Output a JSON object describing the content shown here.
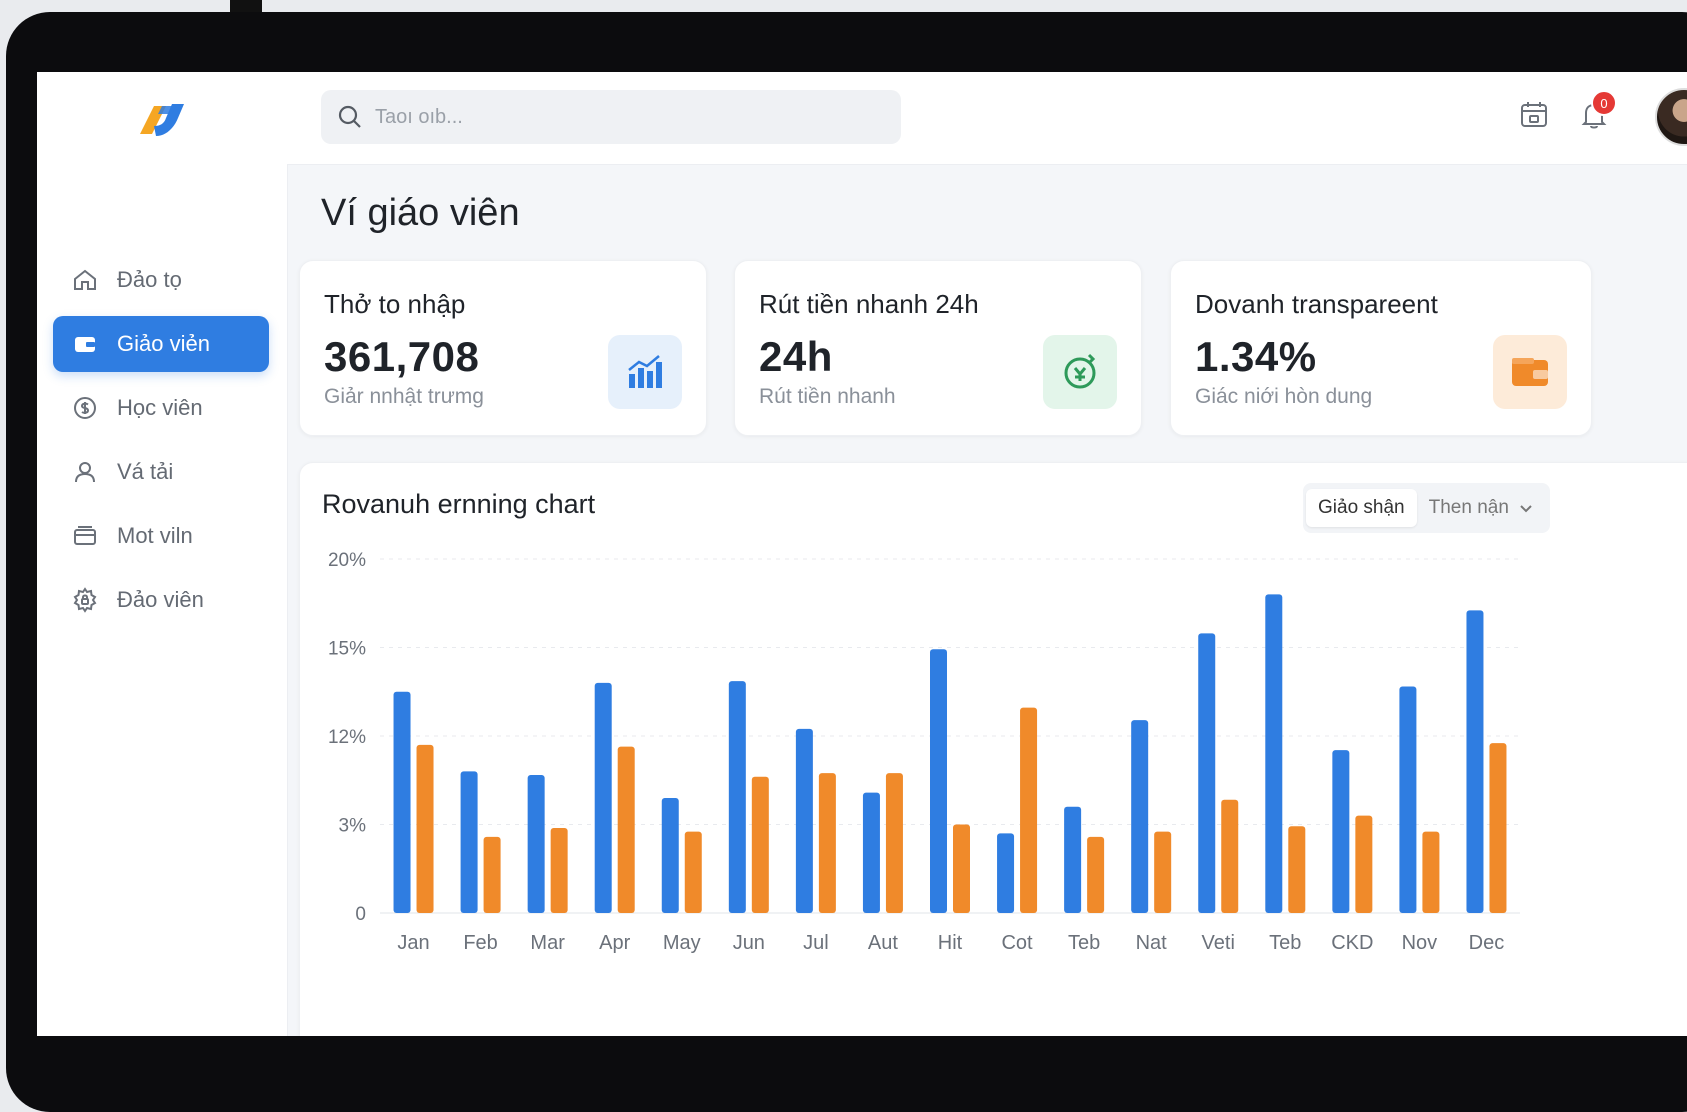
{
  "app": {
    "search_placeholder": "Taoı oıb...",
    "notification_count": "0"
  },
  "sidebar": {
    "items": [
      {
        "label": "Đảo tọ",
        "icon": "home-icon",
        "active": false
      },
      {
        "label": "Giảo viẻn",
        "icon": "wallet-icon",
        "active": true
      },
      {
        "label": "Học viên",
        "icon": "dollar-circle-icon",
        "active": false
      },
      {
        "label": "Vá tải",
        "icon": "user-icon",
        "active": false
      },
      {
        "label": "Mot viln",
        "icon": "card-icon",
        "active": false
      },
      {
        "label": "Đảo viên",
        "icon": "settings-lock-icon",
        "active": false
      }
    ]
  },
  "page": {
    "title": "Ví giáo viên"
  },
  "cards": [
    {
      "title": "Thở to nhập",
      "value": "361,708",
      "sub": "Giảr nnhật trưmg",
      "icon": "bar-chart-icon",
      "icon_bg": "#e6f0fb",
      "icon_color": "#2f7de1"
    },
    {
      "title": "Rút tiền nhanh 24h",
      "value": "24h",
      "sub": "Rút tiền nhanh",
      "icon": "money-clock-icon",
      "icon_bg": "#e3f5ea",
      "icon_color": "#2e9a5a"
    },
    {
      "title": "Dovanh transpareent",
      "value": "1.34%",
      "sub": "Giác niới hòn dung",
      "icon": "wallet-orange-icon",
      "icon_bg": "#fdebd9",
      "icon_color": "#f08a2a"
    }
  ],
  "chart_panel": {
    "seg_active": "Giảo shận",
    "seg_other": "Then nận"
  },
  "chart_data": {
    "type": "bar",
    "title": "Rovanuh ernning chart",
    "categories": [
      "Jan",
      "Feb",
      "Mar",
      "Apr",
      "May",
      "Jun",
      "Jul",
      "Aut",
      "Hit",
      "Cot",
      "Teb",
      "Nat",
      "Veti",
      "Teb",
      "CKD",
      "Nov",
      "Dec"
    ],
    "y_tick_labels": [
      "0",
      "3%",
      "12%",
      "15%",
      "20%"
    ],
    "ylim": [
      0,
      20
    ],
    "grid": true,
    "series": [
      {
        "color": "#2f7de1",
        "values": [
          12.5,
          8.0,
          7.8,
          13.0,
          6.5,
          13.1,
          10.4,
          6.8,
          14.9,
          4.5,
          6.0,
          10.9,
          15.8,
          18.0,
          9.2,
          12.8,
          17.1
        ]
      },
      {
        "color": "#f08a2a",
        "values": [
          9.5,
          4.3,
          4.8,
          9.4,
          4.6,
          7.7,
          7.9,
          7.9,
          5.0,
          11.6,
          4.3,
          4.6,
          6.4,
          4.9,
          5.5,
          4.6,
          9.6
        ]
      }
    ]
  }
}
